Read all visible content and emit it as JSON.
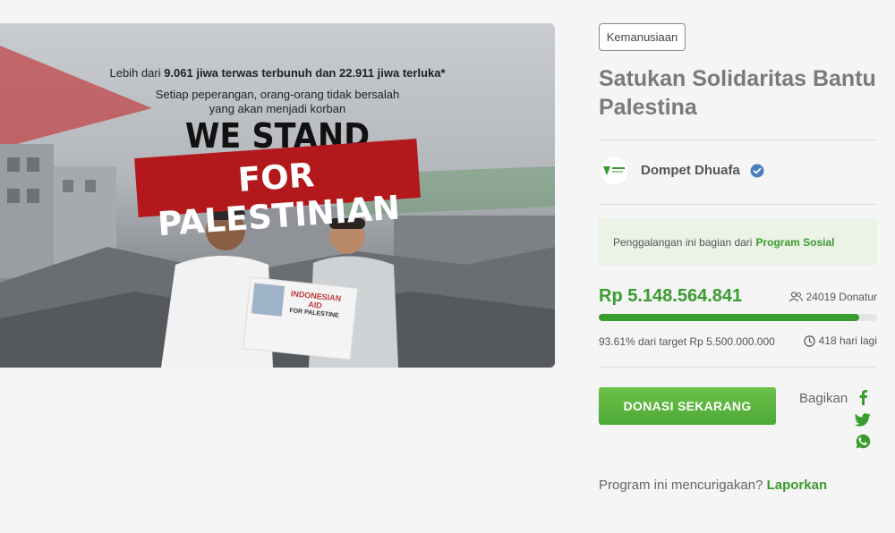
{
  "banner": {
    "line1_pre": "Lebih dari ",
    "line1_bold": "9.061 jiwa terwas terbunuh dan 22.911 jiwa terluka*",
    "line2": "Setiap peperangan, orang-orang tidak bersalah",
    "line3": "yang akan menjadi korban",
    "headline1": "WE STAND",
    "headline2": "FOR PALESTINIAN",
    "box_text1": "INDONESIAN",
    "box_text2": "AID",
    "box_text3": "FOR PALESTINE"
  },
  "campaign": {
    "category": "Kemanusiaan",
    "title": "Satukan Solidaritas Bantu Palestina",
    "organizer": "Dompet Dhuafa",
    "info_prefix": "Penggalangan ini bagian dari",
    "info_link": "Program Sosial",
    "amount": "Rp 5.148.564.841",
    "donors": "24019 Donatur",
    "progress_percent": 93.61,
    "progress_text": "93.61% dari target Rp 5.500.000.000",
    "days_left": "418 hari lagi",
    "donate_label": "DONASI SEKARANG",
    "share_label": "Bagikan",
    "report_prefix": "Program ini mencurigakan?",
    "report_link": "Laporkan"
  },
  "colors": {
    "accent": "#3a9b2e",
    "progress_track": "#e5e5e5",
    "info_bg": "#ebf3e6",
    "flag_red": "#b3191c"
  }
}
